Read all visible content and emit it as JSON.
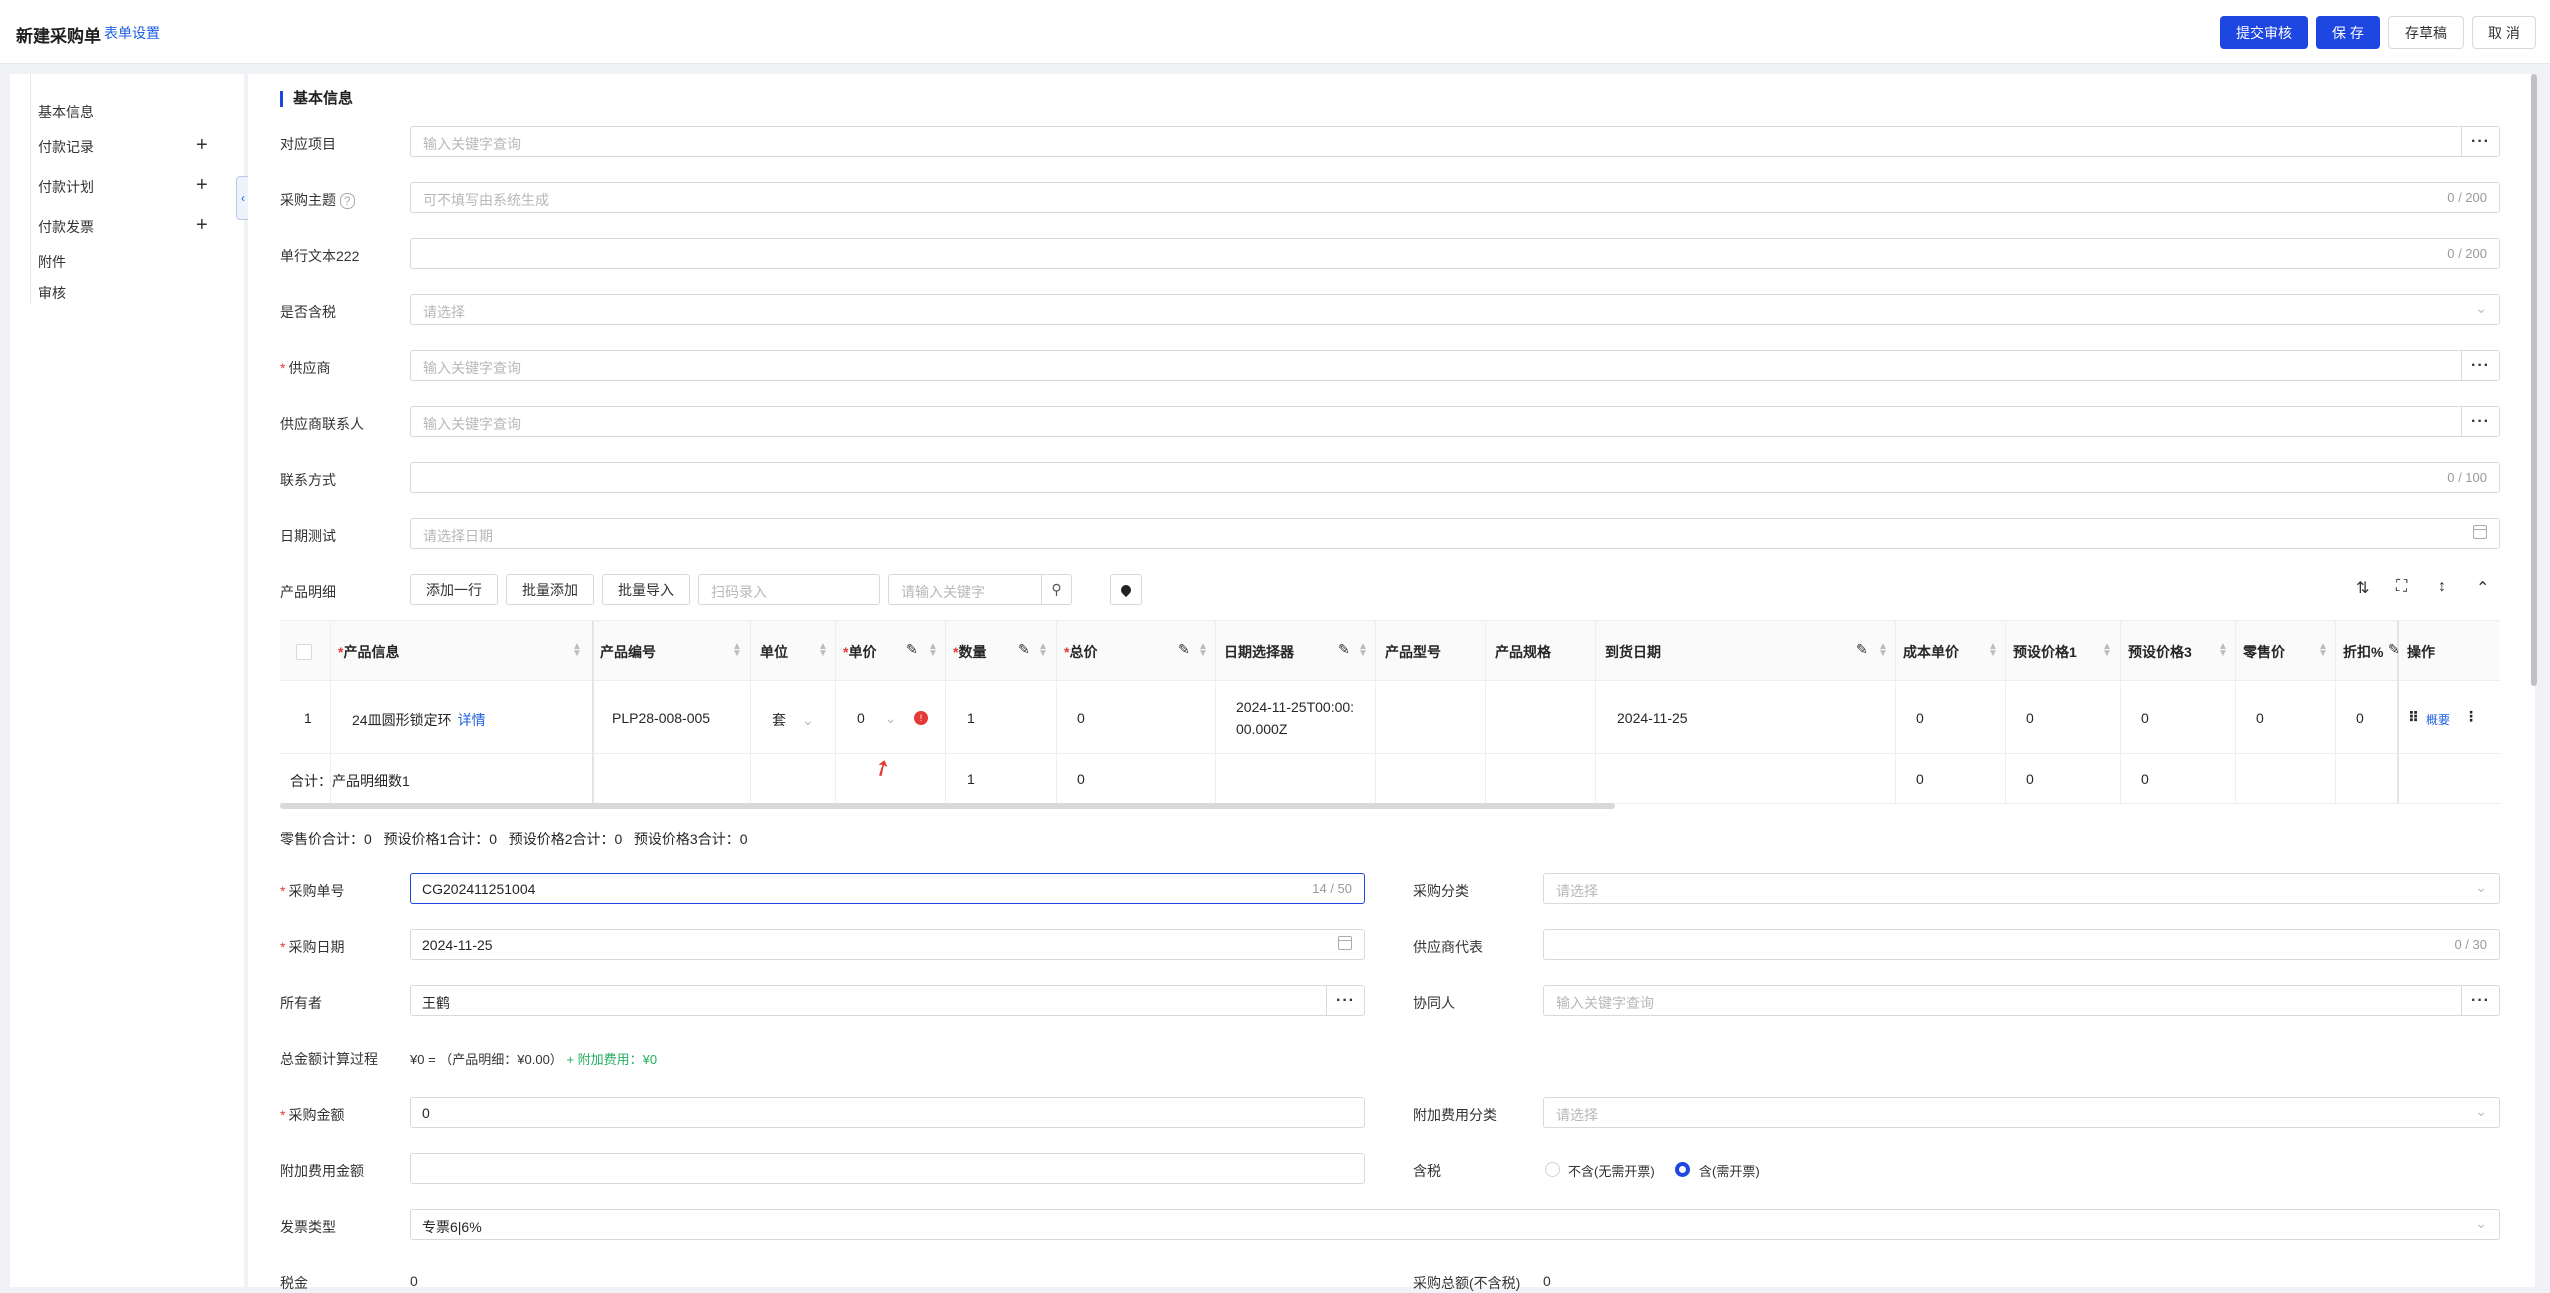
{
  "header": {
    "title": "新建采购单",
    "form_settings": "表单设置",
    "submit_review": "提交审核",
    "save": "保 存",
    "save_draft": "存草稿",
    "cancel": "取 消"
  },
  "sidebar": {
    "items": [
      {
        "label": "基本信息",
        "plus": false
      },
      {
        "label": "付款记录",
        "plus": true
      },
      {
        "label": "付款计划",
        "plus": true
      },
      {
        "label": "付款发票",
        "plus": true
      },
      {
        "label": "附件",
        "plus": false
      },
      {
        "label": "审核",
        "plus": false
      }
    ]
  },
  "section": {
    "title": "基本信息"
  },
  "fields": {
    "project": {
      "label": "对应项目",
      "placeholder": "输入关键字查询"
    },
    "subject": {
      "label": "采购主题",
      "placeholder": "可不填写由系统生成",
      "count": "0 / 200"
    },
    "text222": {
      "label": "单行文本222",
      "count": "0 / 200"
    },
    "tax_included": {
      "label": "是否含税",
      "placeholder": "请选择"
    },
    "supplier": {
      "label": "供应商",
      "placeholder": "输入关键字查询"
    },
    "supplier_contact": {
      "label": "供应商联系人",
      "placeholder": "输入关键字查询"
    },
    "contact_method": {
      "label": "联系方式",
      "count": "0 / 100"
    },
    "date_test": {
      "label": "日期测试",
      "placeholder": "请选择日期"
    }
  },
  "product_toolbar": {
    "label": "产品明细",
    "add_row": "添加一行",
    "batch_add": "批量添加",
    "batch_import": "批量导入",
    "scan_placeholder": "扫码录入",
    "search_placeholder": "请输入关键字"
  },
  "table": {
    "columns": [
      "产品信息",
      "产品编号",
      "单位",
      "单价",
      "数量",
      "总价",
      "日期选择器",
      "产品型号",
      "产品规格",
      "到货日期",
      "成本单价",
      "预设价格1",
      "预设价格3",
      "零售价",
      "折扣%",
      "操作"
    ],
    "row": {
      "index": "1",
      "product": "24皿圆形锁定环",
      "detail": "详情",
      "code": "PLP28-008-005",
      "unit": "套",
      "price": "0",
      "qty": "1",
      "total": "0",
      "datetime_1": "2024-11-25T00:00:",
      "datetime_2": "00.000Z",
      "model": "",
      "spec": "",
      "arrival": "2024-11-25",
      "cost": "0",
      "preset1": "0",
      "preset3": "0",
      "retail": "0",
      "discount": "0",
      "action": "概要"
    },
    "summary": {
      "label": "合计：产品明细数1",
      "qty": "1",
      "total": "0",
      "cost": "0",
      "preset1": "0",
      "preset3": "0"
    }
  },
  "totals_line": "零售价合计：0   预设价格1合计：0   预设价格2合计：0   预设价格3合计：0",
  "form2": {
    "order_no": {
      "label": "采购单号",
      "value": "CG202411251004",
      "count": "14 / 50"
    },
    "category": {
      "label": "采购分类",
      "placeholder": "请选择"
    },
    "order_date": {
      "label": "采购日期",
      "value": "2024-11-25"
    },
    "supplier_rep": {
      "label": "供应商代表",
      "count": "0 / 30"
    },
    "owner": {
      "label": "所有者",
      "value": "王鹤"
    },
    "collaborator": {
      "label": "协同人",
      "placeholder": "输入关键字查询"
    },
    "calc": {
      "label": "总金额计算过程",
      "prefix": "¥0 = （产品明细：¥0.00）",
      "extra": "+ 附加费用：¥0"
    },
    "amount": {
      "label": "采购金额",
      "value": "0"
    },
    "fee_category": {
      "label": "附加费用分类",
      "placeholder": "请选择"
    },
    "fee_amount": {
      "label": "附加费用金额"
    },
    "tax": {
      "label": "含税",
      "option1": "不含(无需开票)",
      "option2": "含(需开票)"
    },
    "invoice_type": {
      "label": "发票类型",
      "value": "专票6|6%"
    },
    "tax_amount": {
      "label": "税金",
      "value": "0"
    },
    "total_excl": {
      "label": "采购总额(不含税)",
      "value": "0"
    }
  }
}
